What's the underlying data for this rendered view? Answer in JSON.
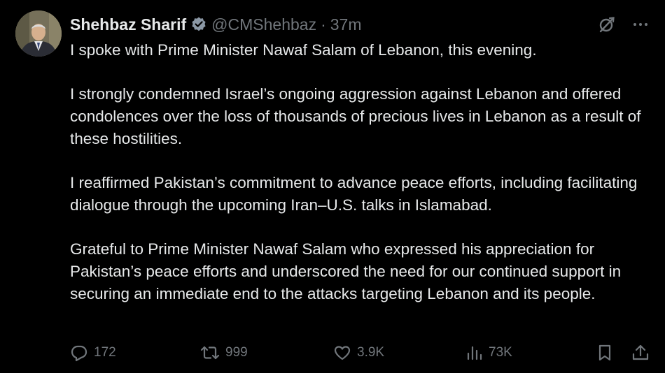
{
  "author": {
    "display_name": "Shehbaz Sharif",
    "handle": "@CMShehbaz",
    "separator": "·",
    "time_ago": "37m",
    "verified": true,
    "verified_color": "#71767b"
  },
  "tweet": {
    "paragraphs": [
      "I spoke with Prime Minister Nawaf Salam of Lebanon, this evening.",
      "I strongly condemned Israel’s ongoing aggression against Lebanon and offered condolences over the loss of thousands of precious lives in Lebanon as a result of these hostilities.",
      "I reaffirmed Pakistan’s commitment to advance peace efforts, including facilitating dialogue through the upcoming Iran–U.S. talks in Islamabad.",
      "Grateful to Prime Minister Nawaf Salam who expressed his appreciation for Pakistan’s peace efforts and underscored the need for our continued support in securing an immediate end to the attacks targeting Lebanon and its people."
    ]
  },
  "metrics": {
    "replies": "172",
    "reposts": "999",
    "likes": "3.9K",
    "views": "73K"
  },
  "icons": {
    "grok": "grok-icon",
    "more": "more-icon",
    "reply": "reply-icon",
    "repost": "repost-icon",
    "like": "like-icon",
    "views": "views-icon",
    "bookmark": "bookmark-icon",
    "share": "share-icon"
  },
  "colors": {
    "background": "#000000",
    "text": "#e7e9ea",
    "secondary": "#71767b"
  }
}
